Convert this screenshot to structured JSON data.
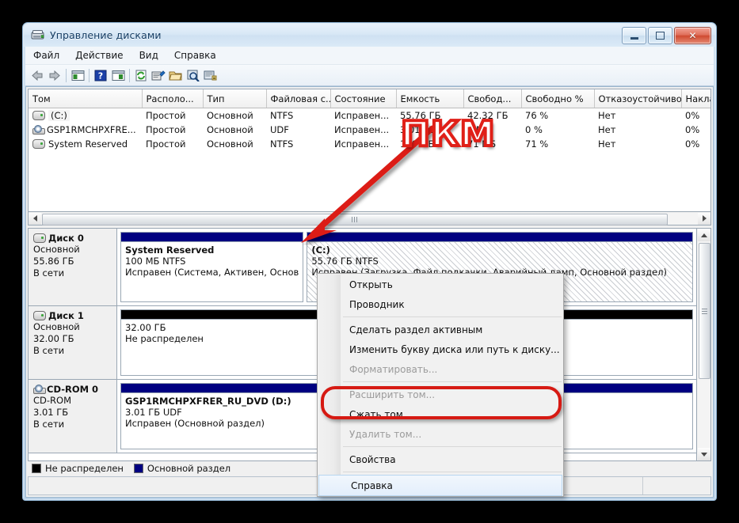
{
  "window": {
    "title": "Управление дисками",
    "icon": "disk-management-icon",
    "buttons": {
      "minimize": "—",
      "maximize": "□",
      "close": "✕"
    }
  },
  "menubar": {
    "items": [
      {
        "label": "Файл",
        "name": "menu-file"
      },
      {
        "label": "Действие",
        "name": "menu-action"
      },
      {
        "label": "Вид",
        "name": "menu-view"
      },
      {
        "label": "Справка",
        "name": "menu-help"
      }
    ]
  },
  "toolbar": {
    "items": [
      {
        "name": "back-arrow-icon"
      },
      {
        "name": "forward-arrow-icon"
      },
      {
        "name": "show-hide-console-tree-icon"
      },
      {
        "name": "help-question-icon"
      },
      {
        "name": "show-hide-action-pane-icon"
      },
      {
        "name": "refresh-icon"
      },
      {
        "name": "properties-icon"
      },
      {
        "name": "open-folder-icon"
      },
      {
        "name": "search-icon"
      },
      {
        "name": "rescan-disks-icon"
      }
    ]
  },
  "volume_list": {
    "columns": [
      "Том",
      "Располо...",
      "Тип",
      "Файловая с...",
      "Состояние",
      "Емкость",
      "Свобод...",
      "Свободно %",
      "Отказоустойчиво...",
      "Накла"
    ],
    "rows": [
      {
        "icon": "hdd-icon",
        "volume": "(C:)",
        "layout": "Простой",
        "type": "Основной",
        "fs": "NTFS",
        "status": "Исправен...",
        "capacity": "55.76 ГБ",
        "free": "42.32 ГБ",
        "free_pct": "76 %",
        "fault_tolerance": "Нет",
        "overhead": "0%",
        "selected": true
      },
      {
        "icon": "cd-icon",
        "volume": "GSP1RMCHPXFRE...",
        "layout": "Простой",
        "type": "Основной",
        "fs": "UDF",
        "status": "Исправен...",
        "capacity": "3.01 ГБ",
        "free": "0 МБ",
        "free_pct": "0 %",
        "fault_tolerance": "Нет",
        "overhead": "0%",
        "selected": false
      },
      {
        "icon": "hdd-icon",
        "volume": "System Reserved",
        "layout": "Простой",
        "type": "Основной",
        "fs": "NTFS",
        "status": "Исправен...",
        "capacity": "100 МБ",
        "free": "71 МБ",
        "free_pct": "71 %",
        "fault_tolerance": "Нет",
        "overhead": "0%",
        "selected": false
      }
    ]
  },
  "graphic_view": {
    "disks": [
      {
        "name": "Диск 0",
        "icon": "hdd-icon",
        "type": "Основной",
        "size": "55.86 ГБ",
        "state": "В сети",
        "partitions": [
          {
            "cap_color": "#000080",
            "line1": "System Reserved",
            "line2": "100 МБ NTFS",
            "line3": "Исправен (Система, Активен, Основ",
            "striped": false,
            "width_pct": 24
          },
          {
            "cap_color": "#000080",
            "line1": "(C:)",
            "line2": "55.76 ГБ NTFS",
            "line3": "Исправен (Загрузка, Файл подкачки, Аварийный дамп, Основной раздел)",
            "striped": true,
            "width_pct": 76
          }
        ]
      },
      {
        "name": "Диск 1",
        "icon": "hdd-icon",
        "type": "Основной",
        "size": "32.00 ГБ",
        "state": "В сети",
        "partitions": [
          {
            "cap_color": "#000000",
            "line1": "",
            "line2": "32.00 ГБ",
            "line3": "Не распределен",
            "striped": false,
            "width_pct": 100
          }
        ]
      },
      {
        "name": "CD-ROM 0",
        "icon": "cd-icon",
        "type": "CD-ROM",
        "size": "3.01 ГБ",
        "state": "В сети",
        "partitions": [
          {
            "cap_color": "#000080",
            "line1": "GSP1RMCHPXFRER_RU_DVD  (D:)",
            "line2": "3.01 ГБ UDF",
            "line3": "Исправен (Основной раздел)",
            "striped": false,
            "width_pct": 100
          }
        ]
      }
    ],
    "legend": [
      {
        "color": "#000000",
        "label": "Не распределен"
      },
      {
        "color": "#000080",
        "label": "Основной раздел"
      }
    ]
  },
  "context_menu": {
    "items": [
      {
        "label": "Открыть",
        "state": "normal",
        "name": "ctx-open"
      },
      {
        "label": "Проводник",
        "state": "normal",
        "name": "ctx-explorer"
      },
      {
        "label": "SEP",
        "state": "separator",
        "name": "ctx-separator-1"
      },
      {
        "label": "Сделать раздел активным",
        "state": "normal",
        "name": "ctx-mark-partition-active"
      },
      {
        "label": "Изменить букву диска или путь к диску...",
        "state": "normal",
        "name": "ctx-change-drive-letter"
      },
      {
        "label": "Форматировать...",
        "state": "disabled",
        "name": "ctx-format"
      },
      {
        "label": "SEP",
        "state": "separator",
        "name": "ctx-separator-2"
      },
      {
        "label": "Расширить том...",
        "state": "disabled",
        "name": "ctx-extend-volume"
      },
      {
        "label": "Сжать том...",
        "state": "normal",
        "name": "ctx-shrink-volume"
      },
      {
        "label": "Удалить том...",
        "state": "disabled",
        "name": "ctx-delete-volume"
      },
      {
        "label": "SEP",
        "state": "separator",
        "name": "ctx-separator-3"
      },
      {
        "label": "Свойства",
        "state": "normal",
        "name": "ctx-properties"
      },
      {
        "label": "SEP",
        "state": "separator",
        "name": "ctx-separator-4"
      },
      {
        "label": "Справка",
        "state": "highlight",
        "name": "ctx-help"
      }
    ]
  },
  "annotations": {
    "pkm_label": "ПКМ",
    "pkm_color": "#e02018",
    "highlight_color": "#d61a13"
  },
  "scrollbars": {
    "horizontal": {
      "left_arrow": "◀",
      "right_arrow": "▶"
    },
    "vertical": {
      "up_arrow": "▲",
      "down_arrow": "▼"
    }
  }
}
